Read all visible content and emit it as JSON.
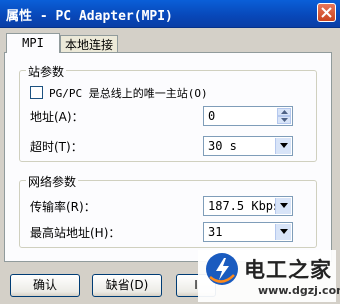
{
  "window": {
    "title": "属性 - PC Adapter(MPI)"
  },
  "tabs": [
    {
      "label": "MPI"
    },
    {
      "label": "本地连接"
    }
  ],
  "station_group": {
    "title": "站参数",
    "only_master_label": "PG/PC 是总线上的唯一主站(O)",
    "only_master_checked": false,
    "address_label": "地址(A)：",
    "address_value": "0",
    "timeout_label": "超时(T)：",
    "timeout_value": "30 s"
  },
  "network_group": {
    "title": "网络参数",
    "baud_label": "传输率(R)：",
    "baud_value": "187.5 Kbps",
    "highest_label": "最高站地址(H)：",
    "highest_value": "31"
  },
  "buttons": {
    "ok": "确认",
    "default": "缺省(D)",
    "partial": "Ⅰ"
  },
  "watermark": {
    "brand": "电工之家",
    "url": "www.dgzj.com"
  }
}
